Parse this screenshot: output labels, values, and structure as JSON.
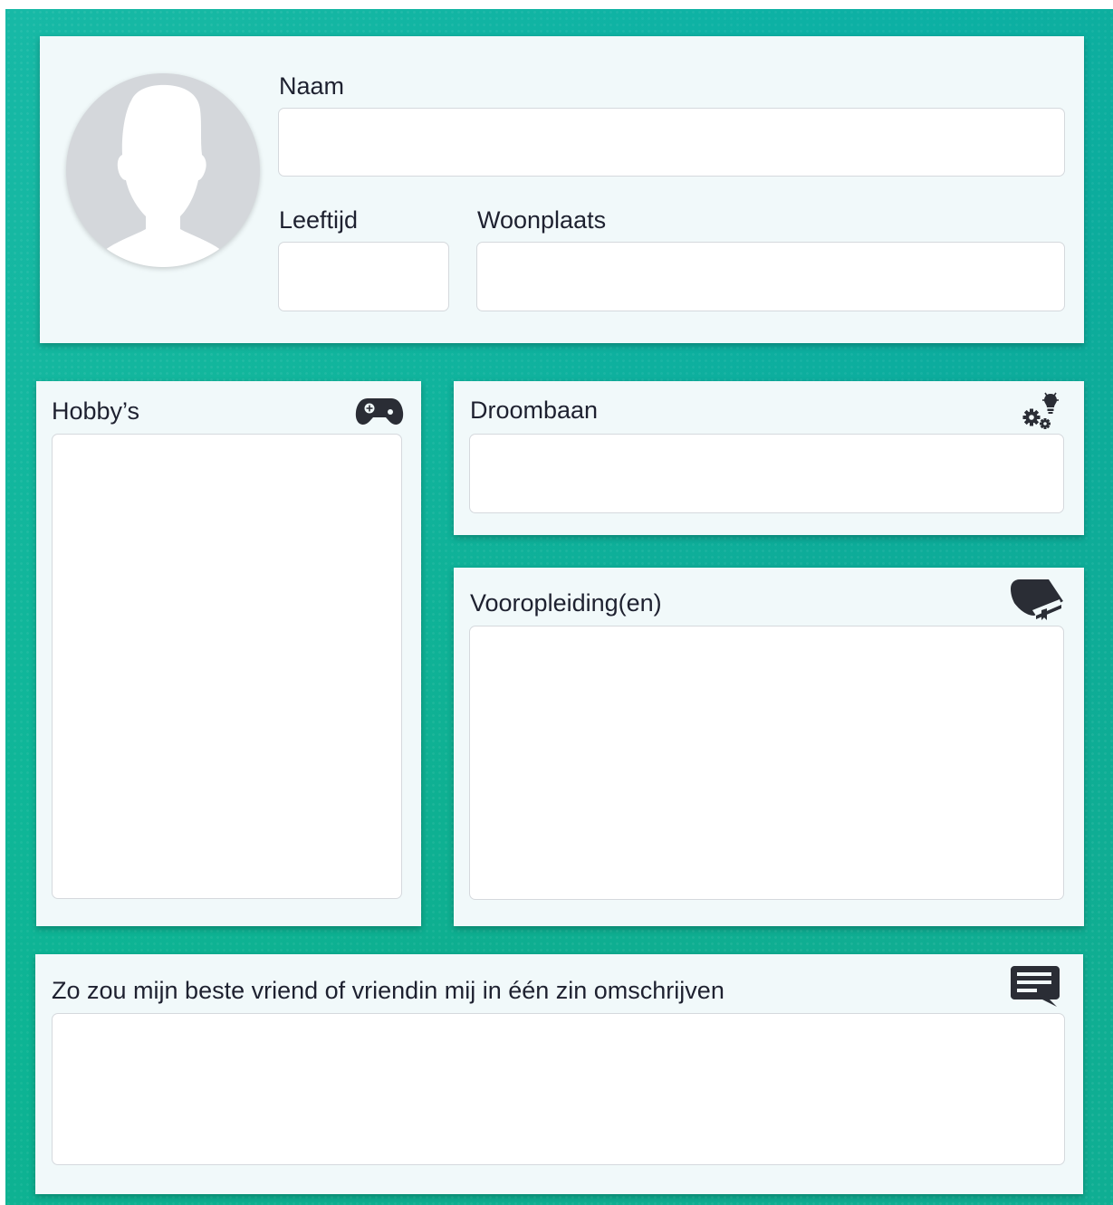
{
  "profile": {
    "name_label": "Naam",
    "age_label": "Leeftijd",
    "city_label": "Woonplaats",
    "name_value": "",
    "age_value": "",
    "city_value": ""
  },
  "hobbies": {
    "label": "Hobby’s",
    "value": "",
    "icon": "game-controller-icon"
  },
  "dream_job": {
    "label": "Droombaan",
    "value": "",
    "icon": "gears-lightbulb-icon"
  },
  "education": {
    "label": "Vooropleiding(en)",
    "value": "",
    "icon": "book-icon"
  },
  "friend_description": {
    "label": "Zo zou mijn beste vriend of vriendin mij in één zin omschrijven",
    "value": "",
    "icon": "message-icon"
  },
  "colors": {
    "background": "#12b49a",
    "card": "#f1f9fa",
    "field": "#ffffff",
    "text": "#1e2130",
    "icon": "#2a2d35",
    "avatar": "#d4d7db"
  }
}
